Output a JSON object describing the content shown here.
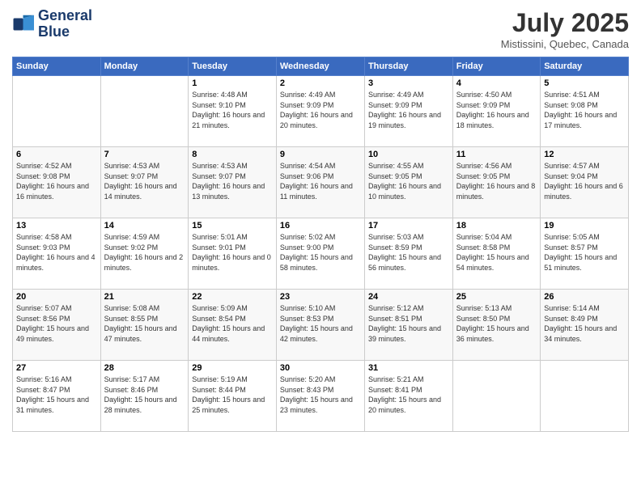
{
  "header": {
    "logo_line1": "General",
    "logo_line2": "Blue",
    "month_year": "July 2025",
    "location": "Mistissini, Quebec, Canada"
  },
  "days_of_week": [
    "Sunday",
    "Monday",
    "Tuesday",
    "Wednesday",
    "Thursday",
    "Friday",
    "Saturday"
  ],
  "weeks": [
    [
      null,
      null,
      {
        "day": 1,
        "sunrise": "4:48 AM",
        "sunset": "9:10 PM",
        "daylight": "16 hours and 21 minutes."
      },
      {
        "day": 2,
        "sunrise": "4:49 AM",
        "sunset": "9:09 PM",
        "daylight": "16 hours and 20 minutes."
      },
      {
        "day": 3,
        "sunrise": "4:49 AM",
        "sunset": "9:09 PM",
        "daylight": "16 hours and 19 minutes."
      },
      {
        "day": 4,
        "sunrise": "4:50 AM",
        "sunset": "9:09 PM",
        "daylight": "16 hours and 18 minutes."
      },
      {
        "day": 5,
        "sunrise": "4:51 AM",
        "sunset": "9:08 PM",
        "daylight": "16 hours and 17 minutes."
      }
    ],
    [
      {
        "day": 6,
        "sunrise": "4:52 AM",
        "sunset": "9:08 PM",
        "daylight": "16 hours and 16 minutes."
      },
      {
        "day": 7,
        "sunrise": "4:53 AM",
        "sunset": "9:07 PM",
        "daylight": "16 hours and 14 minutes."
      },
      {
        "day": 8,
        "sunrise": "4:53 AM",
        "sunset": "9:07 PM",
        "daylight": "16 hours and 13 minutes."
      },
      {
        "day": 9,
        "sunrise": "4:54 AM",
        "sunset": "9:06 PM",
        "daylight": "16 hours and 11 minutes."
      },
      {
        "day": 10,
        "sunrise": "4:55 AM",
        "sunset": "9:05 PM",
        "daylight": "16 hours and 10 minutes."
      },
      {
        "day": 11,
        "sunrise": "4:56 AM",
        "sunset": "9:05 PM",
        "daylight": "16 hours and 8 minutes."
      },
      {
        "day": 12,
        "sunrise": "4:57 AM",
        "sunset": "9:04 PM",
        "daylight": "16 hours and 6 minutes."
      }
    ],
    [
      {
        "day": 13,
        "sunrise": "4:58 AM",
        "sunset": "9:03 PM",
        "daylight": "16 hours and 4 minutes."
      },
      {
        "day": 14,
        "sunrise": "4:59 AM",
        "sunset": "9:02 PM",
        "daylight": "16 hours and 2 minutes."
      },
      {
        "day": 15,
        "sunrise": "5:01 AM",
        "sunset": "9:01 PM",
        "daylight": "16 hours and 0 minutes."
      },
      {
        "day": 16,
        "sunrise": "5:02 AM",
        "sunset": "9:00 PM",
        "daylight": "15 hours and 58 minutes."
      },
      {
        "day": 17,
        "sunrise": "5:03 AM",
        "sunset": "8:59 PM",
        "daylight": "15 hours and 56 minutes."
      },
      {
        "day": 18,
        "sunrise": "5:04 AM",
        "sunset": "8:58 PM",
        "daylight": "15 hours and 54 minutes."
      },
      {
        "day": 19,
        "sunrise": "5:05 AM",
        "sunset": "8:57 PM",
        "daylight": "15 hours and 51 minutes."
      }
    ],
    [
      {
        "day": 20,
        "sunrise": "5:07 AM",
        "sunset": "8:56 PM",
        "daylight": "15 hours and 49 minutes."
      },
      {
        "day": 21,
        "sunrise": "5:08 AM",
        "sunset": "8:55 PM",
        "daylight": "15 hours and 47 minutes."
      },
      {
        "day": 22,
        "sunrise": "5:09 AM",
        "sunset": "8:54 PM",
        "daylight": "15 hours and 44 minutes."
      },
      {
        "day": 23,
        "sunrise": "5:10 AM",
        "sunset": "8:53 PM",
        "daylight": "15 hours and 42 minutes."
      },
      {
        "day": 24,
        "sunrise": "5:12 AM",
        "sunset": "8:51 PM",
        "daylight": "15 hours and 39 minutes."
      },
      {
        "day": 25,
        "sunrise": "5:13 AM",
        "sunset": "8:50 PM",
        "daylight": "15 hours and 36 minutes."
      },
      {
        "day": 26,
        "sunrise": "5:14 AM",
        "sunset": "8:49 PM",
        "daylight": "15 hours and 34 minutes."
      }
    ],
    [
      {
        "day": 27,
        "sunrise": "5:16 AM",
        "sunset": "8:47 PM",
        "daylight": "15 hours and 31 minutes."
      },
      {
        "day": 28,
        "sunrise": "5:17 AM",
        "sunset": "8:46 PM",
        "daylight": "15 hours and 28 minutes."
      },
      {
        "day": 29,
        "sunrise": "5:19 AM",
        "sunset": "8:44 PM",
        "daylight": "15 hours and 25 minutes."
      },
      {
        "day": 30,
        "sunrise": "5:20 AM",
        "sunset": "8:43 PM",
        "daylight": "15 hours and 23 minutes."
      },
      {
        "day": 31,
        "sunrise": "5:21 AM",
        "sunset": "8:41 PM",
        "daylight": "15 hours and 20 minutes."
      },
      null,
      null
    ]
  ]
}
